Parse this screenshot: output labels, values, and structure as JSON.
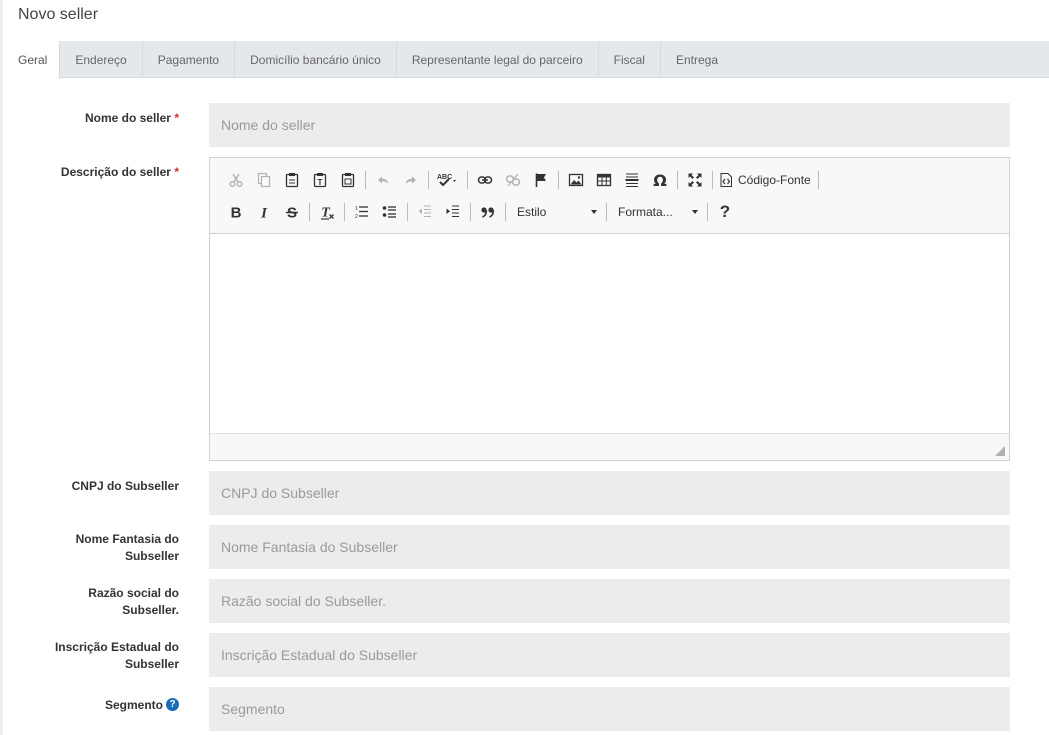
{
  "page": {
    "title": "Novo seller"
  },
  "tabs": [
    {
      "label": "Geral"
    },
    {
      "label": "Endereço"
    },
    {
      "label": "Pagamento"
    },
    {
      "label": "Domicílio bancário único"
    },
    {
      "label": "Representante legal do parceiro"
    },
    {
      "label": "Fiscal"
    },
    {
      "label": "Entrega"
    }
  ],
  "form": {
    "required_mark": "*",
    "nome": {
      "label": "Nome do seller",
      "placeholder": "Nome do seller",
      "value": ""
    },
    "descricao": {
      "label": "Descrição do seller"
    },
    "cnpj": {
      "label": "CNPJ do Subseller",
      "placeholder": "CNPJ do Subseller",
      "value": ""
    },
    "fantasia": {
      "label": "Nome Fantasia do Subseller",
      "placeholder": "Nome Fantasia do Subseller",
      "value": ""
    },
    "razao": {
      "label": "Razão social do Subseller.",
      "placeholder": "Razão social do Subseller.",
      "value": ""
    },
    "inscricao": {
      "label": "Inscrição Estadual do Subseller",
      "placeholder": "Inscrição Estadual do Subseller",
      "value": ""
    },
    "segmento": {
      "label": "Segmento",
      "placeholder": "Segmento",
      "value": "",
      "help": "?"
    }
  },
  "editor": {
    "source_label": "Código-Fonte",
    "style_combo": "Estilo",
    "format_combo": "Formata...",
    "help_label": "?",
    "icons": {
      "cut": "cut-icon",
      "copy": "copy-icon",
      "paste": "paste-icon",
      "paste_text": "paste-text-icon",
      "paste_word": "paste-word-icon",
      "undo": "undo-icon",
      "redo": "redo-icon",
      "spellcheck": "spellcheck-icon",
      "link": "link-icon",
      "unlink": "unlink-icon",
      "anchor": "flag-icon",
      "image": "image-icon",
      "table": "table-icon",
      "hr": "horizontal-rule-icon",
      "special_char": "omega-icon",
      "maximize": "maximize-icon",
      "source": "source-code-icon",
      "bold": "bold-icon",
      "italic": "italic-icon",
      "strike": "strikethrough-icon",
      "remove_format": "remove-format-icon",
      "numbered_list": "numbered-list-icon",
      "bullet_list": "bullet-list-icon",
      "outdent": "outdent-icon",
      "indent": "indent-icon",
      "blockquote": "blockquote-icon"
    }
  }
}
